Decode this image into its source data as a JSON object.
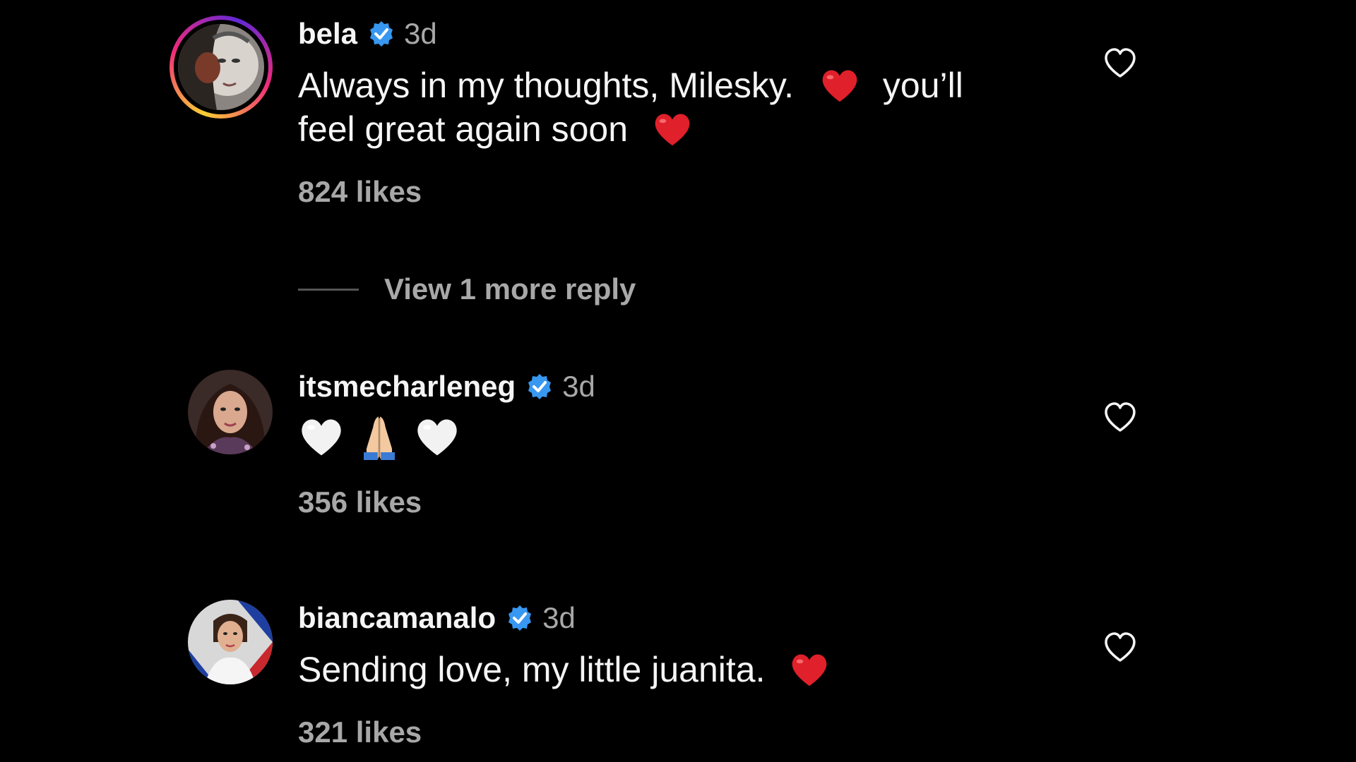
{
  "comments": [
    {
      "username": "bela",
      "verified": true,
      "time": "3d",
      "text_line1": "Always in my thoughts, Milesky.",
      "text_line1_tail": "you’ll",
      "text_line2": "feel great again soon",
      "likes": "824 likes",
      "avatar": "profile-photo",
      "has_story_ring": true
    },
    {
      "username": "itsmecharleneg",
      "verified": true,
      "time": "3d",
      "emojis": [
        "white-heart-emoji",
        "folded-hands-emoji",
        "white-heart-emoji"
      ],
      "likes": "356 likes",
      "avatar": "profile-photo"
    },
    {
      "username": "biancamanalo",
      "verified": true,
      "time": "3d",
      "text": "Sending love, my little juanita.",
      "likes": "321 likes",
      "avatar": "profile-photo"
    }
  ],
  "view_replies": {
    "label": "View 1 more reply"
  },
  "colors": {
    "background": "#000000",
    "text_primary": "#f5f5f5",
    "text_secondary": "#a8a8a8",
    "verified_blue": "#3897f0",
    "red_heart": "#e0202a"
  },
  "icons": {
    "like": "heart-outline-icon",
    "verified": "verified-badge-icon"
  }
}
